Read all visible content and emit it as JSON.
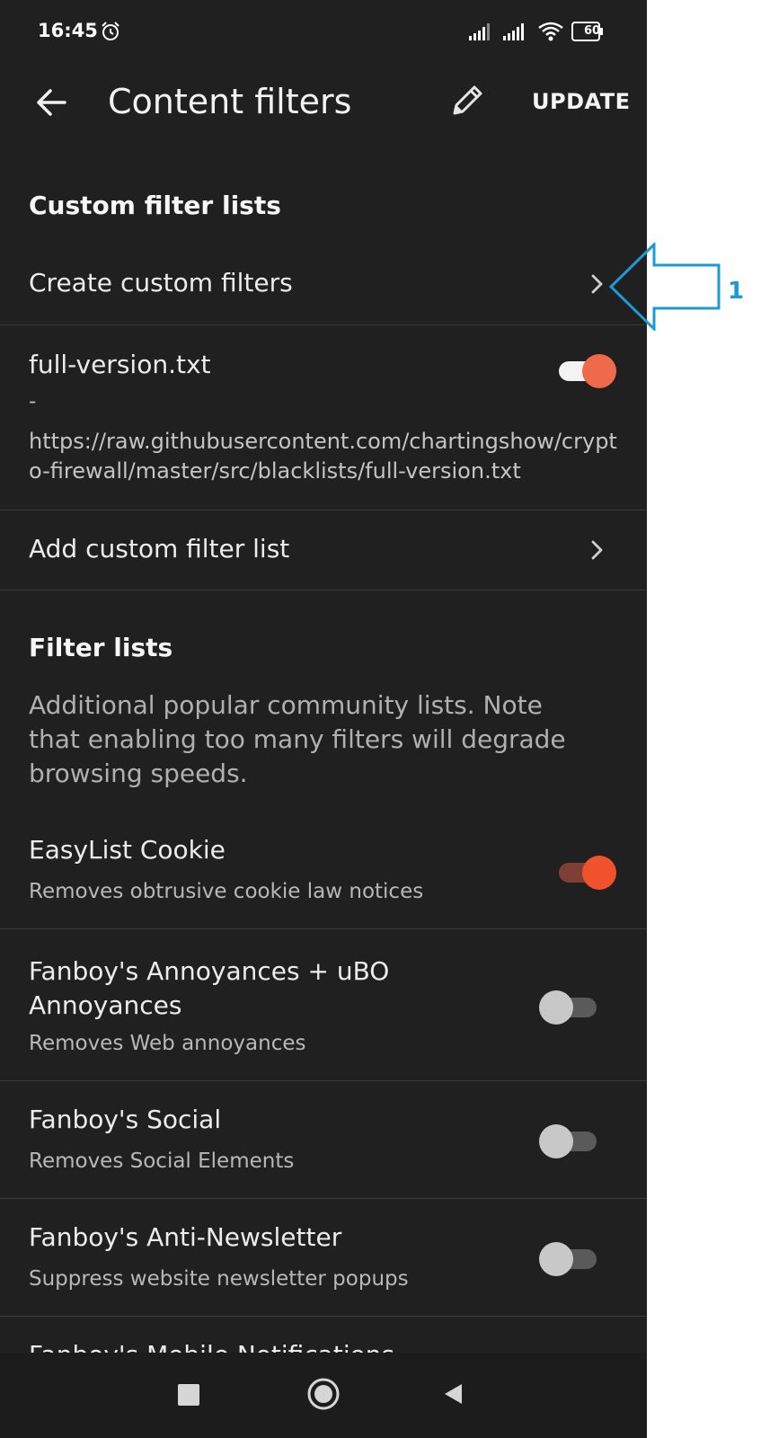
{
  "status_bar": {
    "time": "16:45",
    "battery": "60",
    "icons": [
      "alarm-icon",
      "signal-icon",
      "signal-icon",
      "wifi-icon",
      "battery-icon"
    ]
  },
  "app_bar": {
    "title": "Content filters",
    "update_label": "UPDATE",
    "icons": [
      "back-arrow-icon",
      "pencil-icon"
    ]
  },
  "custom_section": {
    "header": "Custom filter lists",
    "create_label": "Create custom filters",
    "file_item": {
      "title": "full-version.txt",
      "dash": "-",
      "url": "https://raw.githubusercontent.com/chartingshow/crypto-firewall/master/src/blacklists/full-version.txt",
      "enabled": true
    },
    "add_label": "Add custom filter list"
  },
  "filter_section": {
    "header": "Filter lists",
    "description": "Additional popular community lists. Note that enabling too many filters will degrade browsing speeds.",
    "items": [
      {
        "title": "EasyList Cookie",
        "subtitle": "Removes obtrusive cookie law notices",
        "enabled": true
      },
      {
        "title": "Fanboy's Annoyances + uBO Annoyances",
        "subtitle": "Removes Web annoyances",
        "enabled": false
      },
      {
        "title": "Fanboy's Social",
        "subtitle": "Removes Social Elements",
        "enabled": false
      },
      {
        "title": "Fanboy's Anti-Newsletter",
        "subtitle": "Suppress website newsletter popups",
        "enabled": false
      },
      {
        "title": "Fanboy's Mobile Notifications"
      }
    ]
  },
  "annotation": {
    "number": "1",
    "color": "#1b9bd6"
  },
  "colors": {
    "background": "#202020",
    "accent": "#f0522d"
  }
}
